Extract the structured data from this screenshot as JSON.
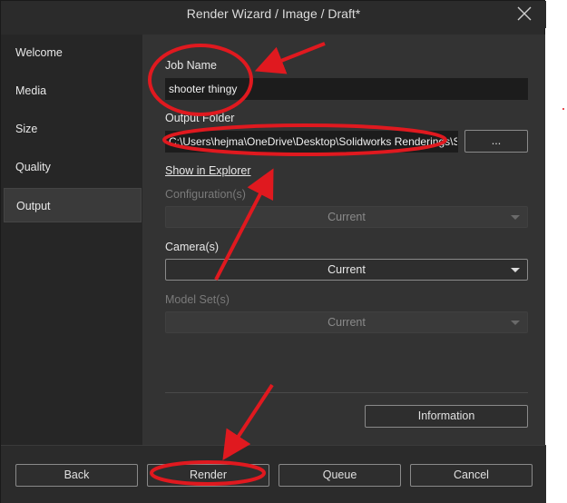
{
  "window": {
    "title": "Render Wizard / Image / Draft*"
  },
  "sidebar": {
    "items": [
      {
        "label": "Welcome"
      },
      {
        "label": "Media"
      },
      {
        "label": "Size"
      },
      {
        "label": "Quality"
      },
      {
        "label": "Output",
        "active": true
      }
    ]
  },
  "output": {
    "job_name_label": "Job Name",
    "job_name_value": "shooter thingy",
    "output_folder_label": "Output Folder",
    "output_folder_value": "C:\\Users\\hejma\\OneDrive\\Desktop\\Solidworks Renderings\\S",
    "browse_label": "...",
    "show_in_explorer": "Show in Explorer",
    "configuration_label": "Configuration(s)",
    "configuration_value": "Current",
    "camera_label": "Camera(s)",
    "camera_value": "Current",
    "model_set_label": "Model Set(s)",
    "model_set_value": "Current",
    "information_label": "Information"
  },
  "footer": {
    "back_label": "Back",
    "render_label": "Render",
    "queue_label": "Queue",
    "cancel_label": "Cancel"
  },
  "colors": {
    "annotation": "#e0191f",
    "window_bg": "#2b2b2b",
    "content_bg": "#333333"
  },
  "icons": {
    "close": "close-icon",
    "dropdown": "chevron-down-icon"
  }
}
